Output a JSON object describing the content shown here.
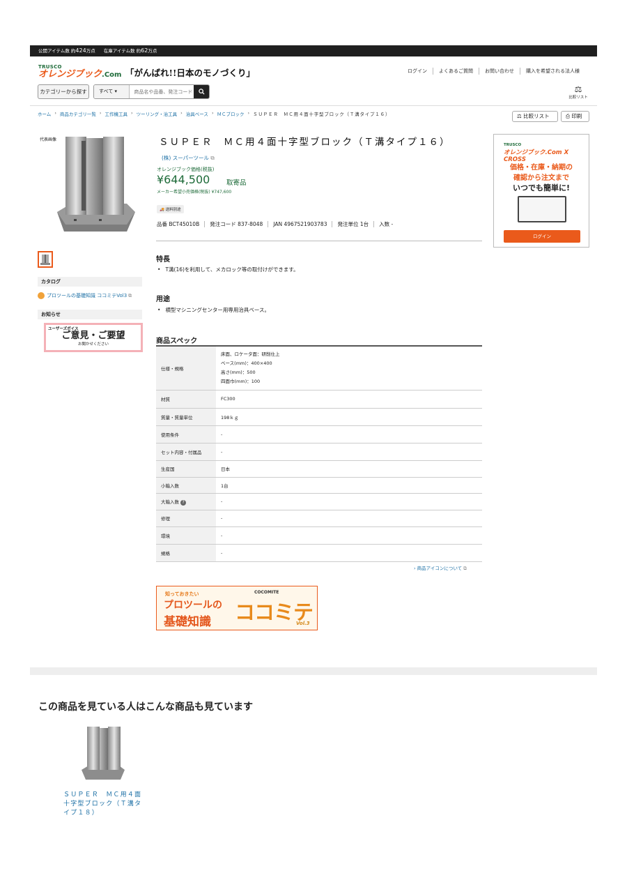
{
  "stats": {
    "public_label": "公開アイテム数 約",
    "public_count": "424",
    "public_unit": "万点",
    "stock_label": "在庫アイテム数 約",
    "stock_count": "62",
    "stock_unit": "万点"
  },
  "header": {
    "logo_trusco": "TRUSCO",
    "logo_main": "オレンジブック",
    "logo_suffix": ".Com",
    "slogan": "「がんばれ!!日本のモノづくり」",
    "nav": [
      "ログイン",
      "よくあるご質問",
      "お問い合わせ",
      "購入を希望される法人様"
    ],
    "category_button": "カテゴリーから探す",
    "search_select": "すべて",
    "search_placeholder": "商品名や品番、発注コード",
    "compare_label": "比較リスト"
  },
  "breadcrumb": [
    "ホーム",
    "商品カテゴリ一覧",
    "工作機工具",
    "ツーリング・治工具",
    "治具ベース",
    "ＭＣブロック"
  ],
  "breadcrumb_current": "ＳＵＰＥＲ　ＭＣ用４面十字型ブロック（Ｔ溝タイプ１６）",
  "actions": {
    "compare": "比較リスト",
    "print": "印刷"
  },
  "sidebar": {
    "rep_image_label": "代表画像",
    "catalog_heading": "カタログ",
    "catalog_link": "プロツールの基礎知識 ココミテVol3",
    "notice_heading": "お知らせ",
    "voice_small": "ユーザーズボイス",
    "voice_big": "ご意見・ご要望",
    "voice_sub": "お聞かせください"
  },
  "product": {
    "title": "ＳＵＰＥＲ　ＭＣ用４面十字型ブロック（Ｔ溝タイプ１６）",
    "maker": "(株) スーパーツール",
    "price_label": "オレンジブック価格(税抜)",
    "price": "¥644,500",
    "stock_status": "取寄品",
    "msrp": "メーカー希望小売価格(税抜) ¥747,600",
    "shipping": "送料別途",
    "codes": [
      "品番 BCT45010B",
      "発注コード 837-8048",
      "JAN 4967521903783",
      "発注単位 1台",
      "入数 -"
    ]
  },
  "features": {
    "heading": "特長",
    "items": [
      "T溝(16)を利用して、メカロック等の取付けができます。"
    ]
  },
  "usage": {
    "heading": "用途",
    "items": [
      "横型マシニングセンター用専用治具ベース。"
    ]
  },
  "spec": {
    "heading": "商品スペック",
    "rows": [
      {
        "key": "仕様・規格",
        "value": [
          "床面、ロケータ面：研削仕上",
          "ベース(mm)：400×400",
          "高さ(mm)：500",
          "四面巾(mm)：100"
        ]
      },
      {
        "key": "材質",
        "value": [
          "FC300"
        ]
      },
      {
        "key": "質量・質量単位",
        "value": [
          "198ｋｇ"
        ]
      },
      {
        "key": "使用条件",
        "value": [
          "-"
        ]
      },
      {
        "key": "セット内容・付属品",
        "value": [
          "-"
        ]
      },
      {
        "key": "生産国",
        "value": [
          "日本"
        ]
      },
      {
        "key": "小箱入数",
        "value": [
          "1台"
        ]
      },
      {
        "key": "大箱入数",
        "value": [
          "-"
        ]
      },
      {
        "key": "修理",
        "value": [
          "-"
        ]
      },
      {
        "key": "環境",
        "value": [
          "-"
        ]
      },
      {
        "key": "規格",
        "value": [
          "-"
        ]
      }
    ],
    "icons_link": "商品アイコンについて"
  },
  "banner": {
    "small": "知っておきたい",
    "line1": "プロツールの",
    "line2": "基礎知識",
    "big": "ココミテ",
    "brand": "COCOMITE",
    "vol": "Vol.3"
  },
  "ad": {
    "trusco": "TRUSCO",
    "brand": "オレンジブック.Com X CROSS",
    "line1": "価格・在庫・納期の",
    "line2": "確認から注文まで",
    "line3": "いつでも簡単に!",
    "button": "ログイン"
  },
  "recommend": {
    "heading": "この商品を見ている人はこんな商品も見ています",
    "items": [
      {
        "name": "ＳＵＰＥＲ　ＭＣ用４面十字型ブロック（Ｔ溝タイプ１８）"
      }
    ]
  }
}
